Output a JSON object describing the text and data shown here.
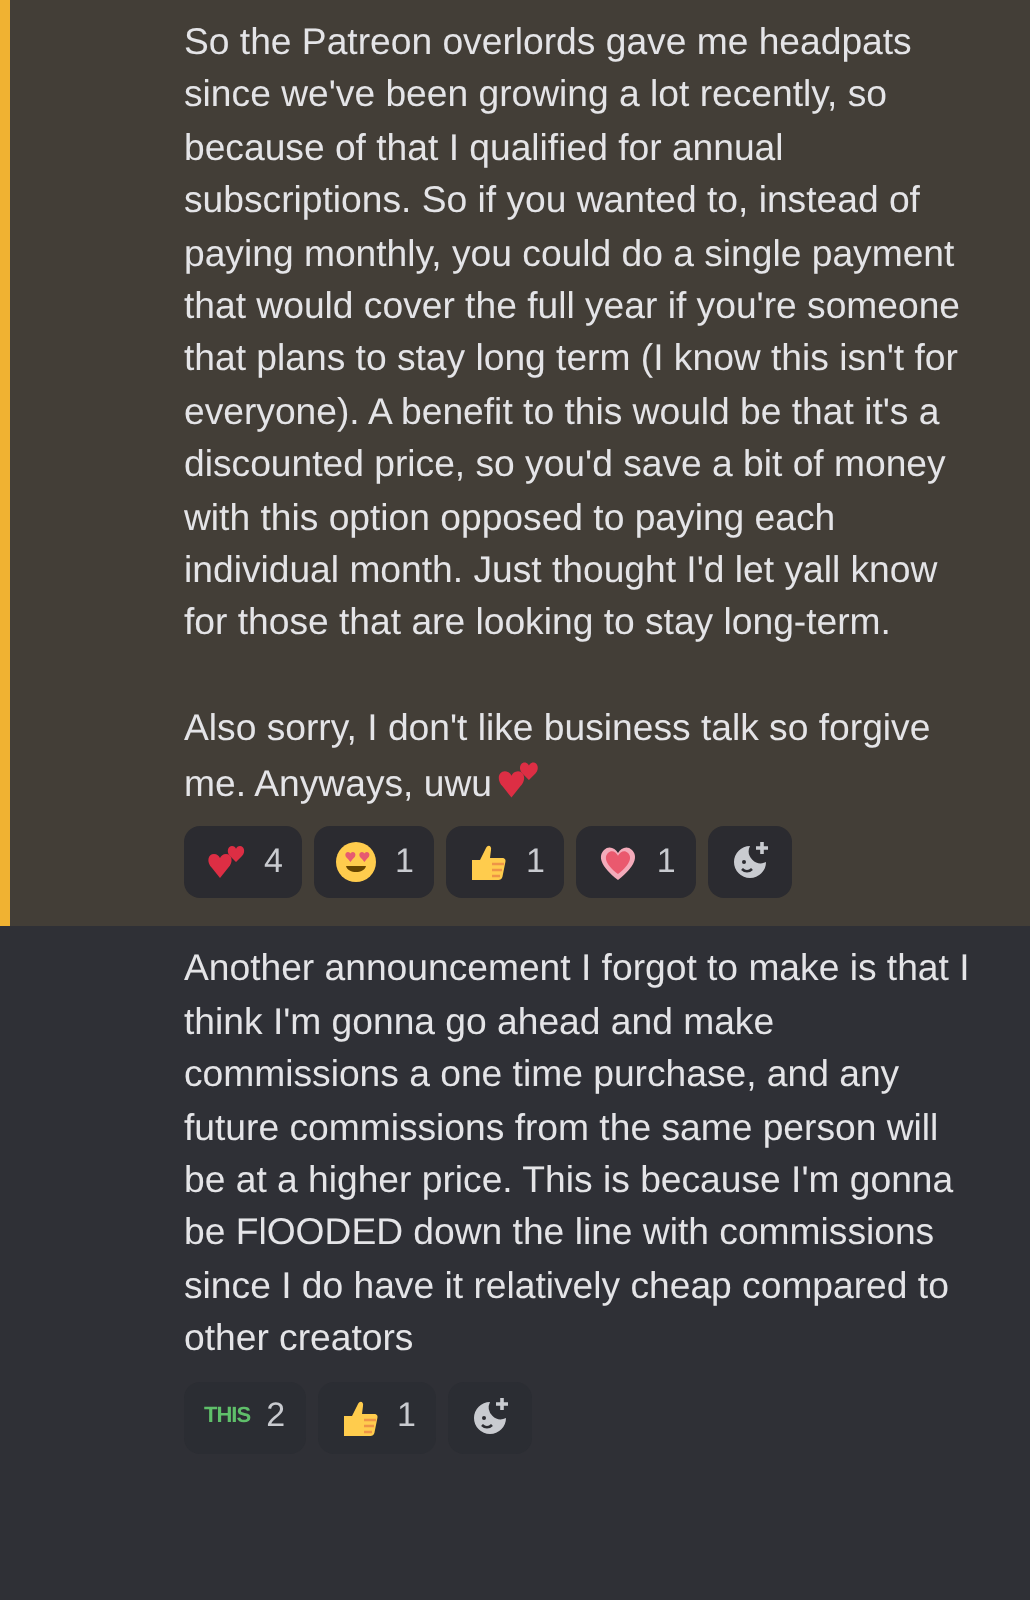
{
  "messages": [
    {
      "highlighted": true,
      "paragraphs": [
        "So the Patreon overlords gave me headpats since we've been growing a lot recently, so because of that I qualified for annual subscriptions. So if you wanted to, instead of paying monthly, you could do a single payment that would cover the full year if you're someone that plans to stay long term (I know this isn't for everyone). A benefit to this would be that it's a discounted price, so you'd save a bit of money with this option opposed to paying each individual month. Just thought I'd let yall know for those that are looking to stay long-term.",
        "Also sorry, I don't like business talk so forgive me. Anyways, uwu"
      ],
      "end_emoji": {
        "kind": "two_hearts"
      },
      "reactions": [
        {
          "kind": "two_hearts",
          "count": "4"
        },
        {
          "kind": "heart_eyes",
          "count": "1"
        },
        {
          "kind": "thumbs_up",
          "count": "1"
        },
        {
          "kind": "heart",
          "count": "1"
        }
      ]
    },
    {
      "highlighted": false,
      "paragraphs": [
        "Another announcement I forgot to make is that I think I'm gonna go ahead and make commissions a one time purchase, and any future commissions from the same person will be at a higher price. This is because I'm gonna be FlOODED down the line with commissions since I do have it relatively cheap compared to other creators"
      ],
      "reactions": [
        {
          "kind": "text",
          "label": "THIS",
          "count": "2"
        },
        {
          "kind": "thumbs_up",
          "count": "1"
        }
      ]
    }
  ]
}
